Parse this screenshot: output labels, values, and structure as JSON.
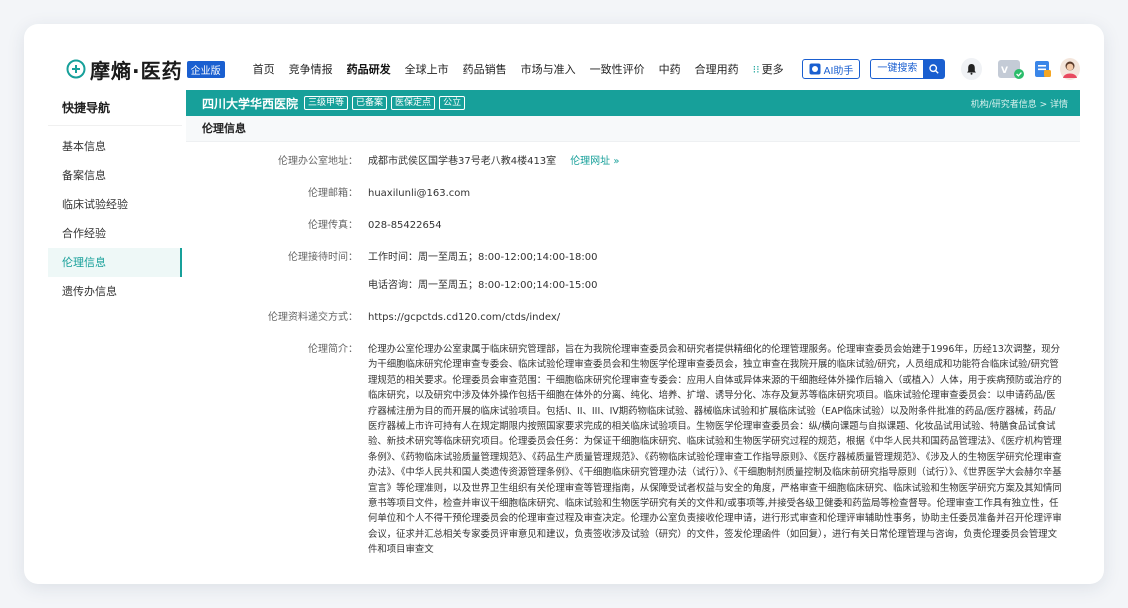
{
  "header": {
    "logo_text": "摩熵·医药",
    "logo_badge": "企业版",
    "nav": [
      "首页",
      "竞争情报",
      "药品研发",
      "全球上市",
      "药品销售",
      "市场与准入",
      "一致性评价",
      "中药",
      "合理用药"
    ],
    "more_label": "更多",
    "ai_label": "AI助手",
    "search_label": "一键搜索",
    "brand_color": "#1a5fd0"
  },
  "sidebar": {
    "title": "快捷导航",
    "items": [
      {
        "label": "基本信息"
      },
      {
        "label": "备案信息"
      },
      {
        "label": "临床试验经验"
      },
      {
        "label": "合作经验"
      },
      {
        "label": "伦理信息"
      },
      {
        "label": "遗传办信息"
      }
    ],
    "active_index": 4,
    "accent_color": "#17a09a"
  },
  "org": {
    "name": "四川大学华西医院",
    "tags": [
      "三级甲等",
      "已备案",
      "医保定点",
      "公立"
    ],
    "breadcrumb": "机构/研究者信息 > 详情"
  },
  "section": {
    "title": "伦理信息"
  },
  "ethics": {
    "address_label": "伦理办公室地址：",
    "address_value": "成都市武侯区国学巷37号老八教4楼413室",
    "website_link": "伦理网址 »",
    "email_label": "伦理邮箱：",
    "email_value": "huaxilunli@163.com",
    "fax_label": "伦理传真：",
    "fax_value": "028-85422654",
    "reception_label": "伦理接待时间：",
    "reception_value_1": "工作时间：周一至周五；8:00-12:00;14:00-18:00",
    "reception_value_2": "电话咨询：周一至周五；8:00-12:00;14:00-15:00",
    "submission_label": "伦理资料递交方式：",
    "submission_value": "https://gcpctds.cd120.com/ctds/index/",
    "intro_label": "伦理简介：",
    "intro_value": "伦理办公室伦理办公室隶属于临床研究管理部，旨在为我院伦理审查委员会和研究者提供精细化的伦理管理服务。伦理审查委员会始建于1996年，历经13次调整，现分为干细胞临床研究伦理审查专委会、临床试验伦理审查委员会和生物医学伦理审查委员会，独立审查在我院开展的临床试验/研究，人员组成和功能符合临床试验/研究管理规范的相关要求。伦理委员会审查范围：干细胞临床研究伦理审查专委会：应用人自体或异体来源的干细胞经体外操作后输入（或植入）人体，用于疾病预防或治疗的临床研究，以及研究中涉及体外操作包括干细胞在体外的分离、纯化、培养、扩增、诱导分化、冻存及复苏等临床研究项目。临床试验伦理审查委员会：以申请药品/医疗器械注册为目的而开展的临床试验项目。包括I、II、III、IV期药物临床试验、器械临床试验和扩展临床试验（EAP临床试验）以及附条件批准的药品/医疗器械，药品/医疗器械上市许可持有人在规定期限内按照国家要求完成的相关临床试验项目。生物医学伦理审查委员会：纵/横向课题与自拟课题、化妆品试用试验、特膳食品试食试验、新技术研究等临床研究项目。伦理委员会任务：为保证干细胞临床研究、临床试验和生物医学研究过程的规范，根据《中华人民共和国药品管理法》、《医疗机构管理条例》、《药物临床试验质量管理规范》、《药品生产质量管理规范》、《药物临床试验伦理审查工作指导原则》、《医疗器械质量管理规范》、《涉及人的生物医学研究伦理审查办法》、《中华人民共和国人类遗传资源管理条例》、《干细胞临床研究管理办法（试行）》、《干细胞制剂质量控制及临床前研究指导原则（试行）》、《世界医学大会赫尔辛基宣言》等伦理准则，以及世界卫生组织有关伦理审查等管理指南，从保障受试者权益与安全的角度，严格审查干细胞临床研究、临床试验和生物医学研究方案及其知情同意书等项目文件，检查并审议干细胞临床研究、临床试验和生物医学研究有关的文件和/或事项等,并接受各级卫健委和药监局等检查督导。伦理审查工作具有独立性，任何单位和个人不得干预伦理委员会的伦理审查过程及审查决定。伦理办公室负责接收伦理申请，进行形式审查和伦理评审辅助性事务，协助主任委员准备并召开伦理评审会议，征求并汇总相关专家委员评审意见和建议，负责签收涉及试验（研究）的文件，签发伦理函件（如回复），进行有关日常伦理管理与咨询，负责伦理委员会管理文件和项目审查文"
  }
}
